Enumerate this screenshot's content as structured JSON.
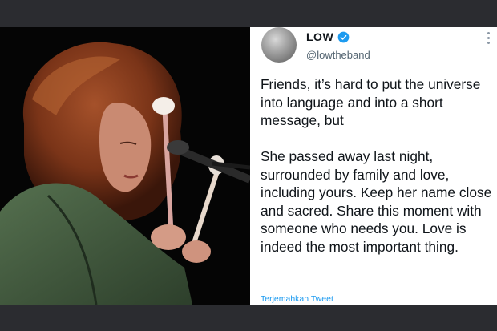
{
  "tweet": {
    "display_name": "LOW",
    "handle": "@lowtheband",
    "text": "Friends, it’s hard to put the universe into language and into a short message, but\n\nShe passed away last night, surrounded by family and love, including yours. Keep her name close and sacred. Share this moment with someone who needs you. Love is indeed the most important thing.",
    "translate_label": "Terjemahkan Tweet"
  },
  "colors": {
    "background": "#2b2c30",
    "accent": "#1d9bf0",
    "text": "#0f1419",
    "secondary_text": "#536471"
  },
  "icons": {
    "verified": "verified-badge-icon",
    "more": "more-options-icon"
  }
}
